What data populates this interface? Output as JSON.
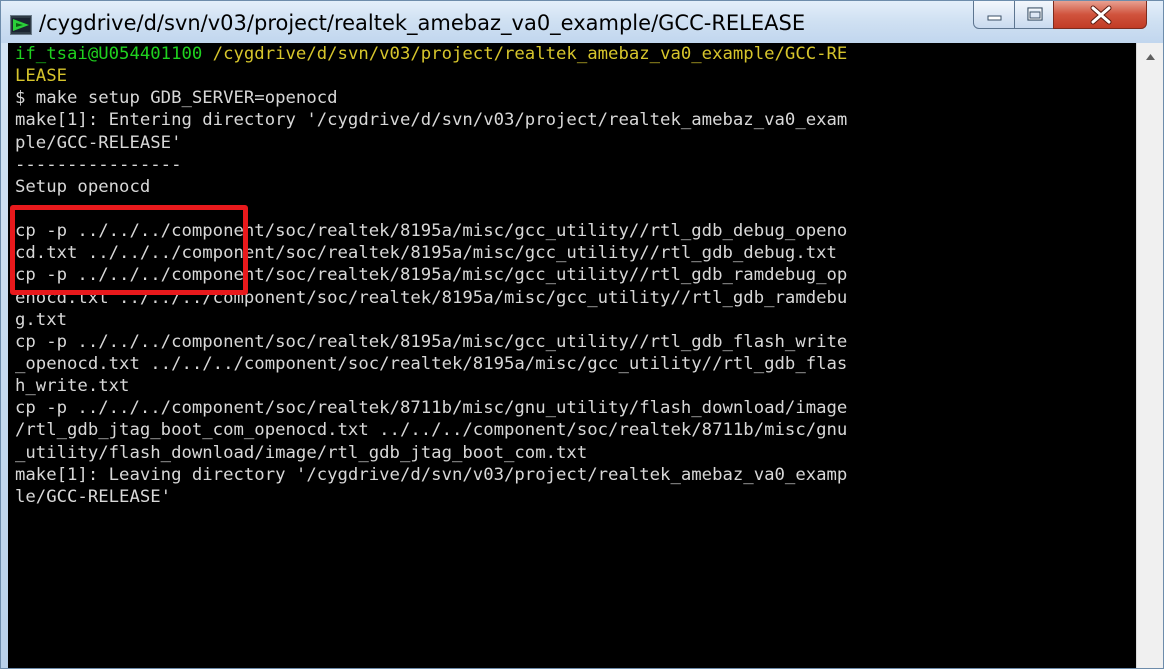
{
  "window": {
    "title": "/cygdrive/d/svn/v03/project/realtek_amebaz_va0_example/GCC-RELEASE"
  },
  "icons": {
    "app": "cygwin-terminal-icon",
    "minimize": "minimize-icon",
    "maximize": "maximize-icon",
    "close": "close-icon",
    "scroll_up": "scroll-up-arrow-icon"
  },
  "colors": {
    "terminal_bg": "#000000",
    "text": "#d8d8d8",
    "prompt_user": "#1fd11f",
    "prompt_path": "#d6c52c",
    "highlight": "#e8191c"
  },
  "terminal": {
    "prompt": {
      "user": "if_tsai@U054401100",
      "path_line1": " /cygdrive/d/svn/v03/project/realtek_amebaz_va0_example/GCC-RE",
      "path_line2": "LEASE"
    },
    "lines": [
      "$ make setup GDB_SERVER=openocd",
      "make[1]: Entering directory '/cygdrive/d/svn/v03/project/realtek_amebaz_va0_exam",
      "ple/GCC-RELEASE'",
      "----------------",
      "Setup openocd",
      "----------------",
      "cp -p ../../../component/soc/realtek/8195a/misc/gcc_utility//rtl_gdb_debug_openo",
      "cd.txt ../../../component/soc/realtek/8195a/misc/gcc_utility//rtl_gdb_debug.txt",
      "cp -p ../../../component/soc/realtek/8195a/misc/gcc_utility//rtl_gdb_ramdebug_op",
      "enocd.txt ../../../component/soc/realtek/8195a/misc/gcc_utility//rtl_gdb_ramdebu",
      "g.txt",
      "cp -p ../../../component/soc/realtek/8195a/misc/gcc_utility//rtl_gdb_flash_write",
      "_openocd.txt ../../../component/soc/realtek/8195a/misc/gcc_utility//rtl_gdb_flas",
      "h_write.txt",
      "cp -p ../../../component/soc/realtek/8711b/misc/gnu_utility/flash_download/image",
      "/rtl_gdb_jtag_boot_com_openocd.txt ../../../component/soc/realtek/8711b/misc/gnu",
      "_utility/flash_download/image/rtl_gdb_jtag_boot_com.txt",
      "make[1]: Leaving directory '/cygdrive/d/svn/v03/project/realtek_amebaz_va0_examp",
      "le/GCC-RELEASE'"
    ]
  }
}
